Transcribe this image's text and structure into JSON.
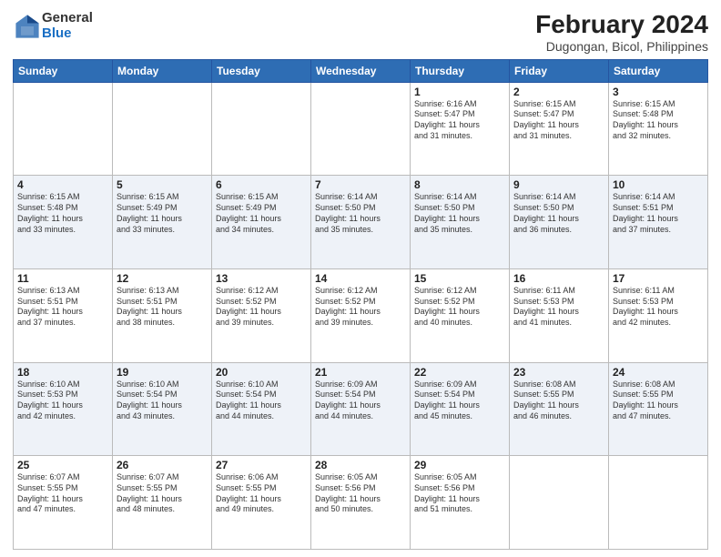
{
  "header": {
    "logo_general": "General",
    "logo_blue": "Blue",
    "title": "February 2024",
    "subtitle": "Dugongan, Bicol, Philippines"
  },
  "days_of_week": [
    "Sunday",
    "Monday",
    "Tuesday",
    "Wednesday",
    "Thursday",
    "Friday",
    "Saturday"
  ],
  "weeks": [
    [
      {
        "day": "",
        "info": ""
      },
      {
        "day": "",
        "info": ""
      },
      {
        "day": "",
        "info": ""
      },
      {
        "day": "",
        "info": ""
      },
      {
        "day": "1",
        "info": "Sunrise: 6:16 AM\nSunset: 5:47 PM\nDaylight: 11 hours\nand 31 minutes."
      },
      {
        "day": "2",
        "info": "Sunrise: 6:15 AM\nSunset: 5:47 PM\nDaylight: 11 hours\nand 31 minutes."
      },
      {
        "day": "3",
        "info": "Sunrise: 6:15 AM\nSunset: 5:48 PM\nDaylight: 11 hours\nand 32 minutes."
      }
    ],
    [
      {
        "day": "4",
        "info": "Sunrise: 6:15 AM\nSunset: 5:48 PM\nDaylight: 11 hours\nand 33 minutes."
      },
      {
        "day": "5",
        "info": "Sunrise: 6:15 AM\nSunset: 5:49 PM\nDaylight: 11 hours\nand 33 minutes."
      },
      {
        "day": "6",
        "info": "Sunrise: 6:15 AM\nSunset: 5:49 PM\nDaylight: 11 hours\nand 34 minutes."
      },
      {
        "day": "7",
        "info": "Sunrise: 6:14 AM\nSunset: 5:50 PM\nDaylight: 11 hours\nand 35 minutes."
      },
      {
        "day": "8",
        "info": "Sunrise: 6:14 AM\nSunset: 5:50 PM\nDaylight: 11 hours\nand 35 minutes."
      },
      {
        "day": "9",
        "info": "Sunrise: 6:14 AM\nSunset: 5:50 PM\nDaylight: 11 hours\nand 36 minutes."
      },
      {
        "day": "10",
        "info": "Sunrise: 6:14 AM\nSunset: 5:51 PM\nDaylight: 11 hours\nand 37 minutes."
      }
    ],
    [
      {
        "day": "11",
        "info": "Sunrise: 6:13 AM\nSunset: 5:51 PM\nDaylight: 11 hours\nand 37 minutes."
      },
      {
        "day": "12",
        "info": "Sunrise: 6:13 AM\nSunset: 5:51 PM\nDaylight: 11 hours\nand 38 minutes."
      },
      {
        "day": "13",
        "info": "Sunrise: 6:12 AM\nSunset: 5:52 PM\nDaylight: 11 hours\nand 39 minutes."
      },
      {
        "day": "14",
        "info": "Sunrise: 6:12 AM\nSunset: 5:52 PM\nDaylight: 11 hours\nand 39 minutes."
      },
      {
        "day": "15",
        "info": "Sunrise: 6:12 AM\nSunset: 5:52 PM\nDaylight: 11 hours\nand 40 minutes."
      },
      {
        "day": "16",
        "info": "Sunrise: 6:11 AM\nSunset: 5:53 PM\nDaylight: 11 hours\nand 41 minutes."
      },
      {
        "day": "17",
        "info": "Sunrise: 6:11 AM\nSunset: 5:53 PM\nDaylight: 11 hours\nand 42 minutes."
      }
    ],
    [
      {
        "day": "18",
        "info": "Sunrise: 6:10 AM\nSunset: 5:53 PM\nDaylight: 11 hours\nand 42 minutes."
      },
      {
        "day": "19",
        "info": "Sunrise: 6:10 AM\nSunset: 5:54 PM\nDaylight: 11 hours\nand 43 minutes."
      },
      {
        "day": "20",
        "info": "Sunrise: 6:10 AM\nSunset: 5:54 PM\nDaylight: 11 hours\nand 44 minutes."
      },
      {
        "day": "21",
        "info": "Sunrise: 6:09 AM\nSunset: 5:54 PM\nDaylight: 11 hours\nand 44 minutes."
      },
      {
        "day": "22",
        "info": "Sunrise: 6:09 AM\nSunset: 5:54 PM\nDaylight: 11 hours\nand 45 minutes."
      },
      {
        "day": "23",
        "info": "Sunrise: 6:08 AM\nSunset: 5:55 PM\nDaylight: 11 hours\nand 46 minutes."
      },
      {
        "day": "24",
        "info": "Sunrise: 6:08 AM\nSunset: 5:55 PM\nDaylight: 11 hours\nand 47 minutes."
      }
    ],
    [
      {
        "day": "25",
        "info": "Sunrise: 6:07 AM\nSunset: 5:55 PM\nDaylight: 11 hours\nand 47 minutes."
      },
      {
        "day": "26",
        "info": "Sunrise: 6:07 AM\nSunset: 5:55 PM\nDaylight: 11 hours\nand 48 minutes."
      },
      {
        "day": "27",
        "info": "Sunrise: 6:06 AM\nSunset: 5:55 PM\nDaylight: 11 hours\nand 49 minutes."
      },
      {
        "day": "28",
        "info": "Sunrise: 6:05 AM\nSunset: 5:56 PM\nDaylight: 11 hours\nand 50 minutes."
      },
      {
        "day": "29",
        "info": "Sunrise: 6:05 AM\nSunset: 5:56 PM\nDaylight: 11 hours\nand 51 minutes."
      },
      {
        "day": "",
        "info": ""
      },
      {
        "day": "",
        "info": ""
      }
    ]
  ]
}
